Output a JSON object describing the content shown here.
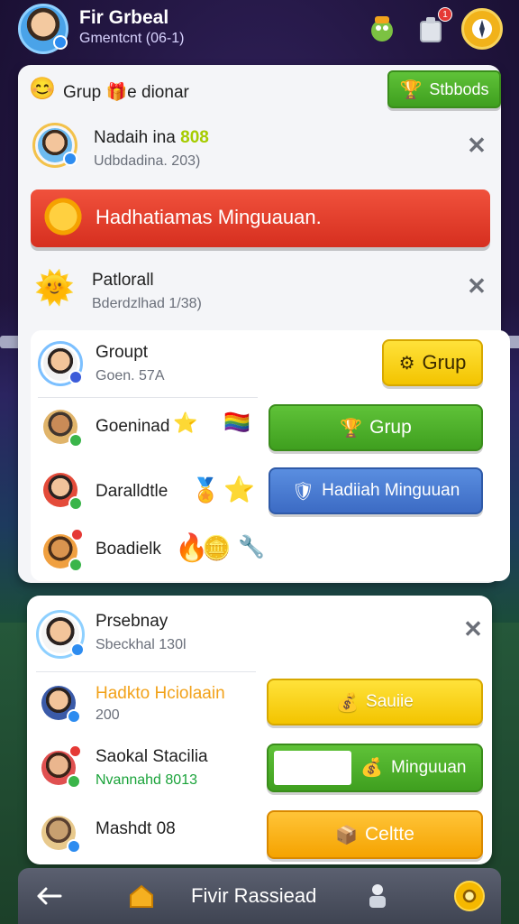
{
  "header": {
    "title": "Fir Grbeal",
    "subtitle": "Gmentcnt (06-1)",
    "icons": [
      "avatar",
      "mascot-icon",
      "inventory-icon",
      "compass-icon"
    ],
    "notif_count": "1"
  },
  "top_panel": {
    "group_title": "Grup 🎁e dionar",
    "group_button": "Stbbods",
    "user_row": {
      "name": "Nadaih ina",
      "badge": "808",
      "sub": "Udbdadina. 203)"
    },
    "banner_text": "Hadhatiamas Minguauan.",
    "patrol_row": {
      "name": "Patlorall",
      "sub": "Bderdzlhad 1/38)"
    }
  },
  "list_panel": {
    "header_row": {
      "name": "Groupt",
      "sub": "Goen. 57A",
      "button": "Grup"
    },
    "rows": [
      {
        "name": "Goeninad",
        "button": "Grup",
        "style": "green"
      },
      {
        "name": "Daralldtle",
        "button": "Hadiiah Minguuan",
        "style": "blue"
      },
      {
        "name": "Boadielk"
      }
    ]
  },
  "bottom_panel": {
    "header_row": {
      "name": "Prsebnay",
      "sub": "Sbeckhal 130l"
    },
    "rows": [
      {
        "name": "Hadkto Hciolaain",
        "sub": "200",
        "button": "Sauiie",
        "style": "yellow"
      },
      {
        "name": "Saokal Stacilia",
        "sub": "Nvannahd 8013",
        "button": "Minguuan",
        "style": "green"
      },
      {
        "name": "Mashdt 08",
        "button": "Celtte",
        "style": "orange"
      }
    ]
  },
  "bottombar": {
    "title": "Fivir Rassiead",
    "icons": [
      "back-arrow-icon",
      "home-icon",
      "character-icon",
      "coin-icon"
    ]
  },
  "colors": {
    "accent_green": "#4cae2a",
    "accent_blue": "#4a7ed4",
    "accent_yellow": "#f6d000",
    "accent_orange": "#f7ad12",
    "banner_red": "#e2402c"
  }
}
